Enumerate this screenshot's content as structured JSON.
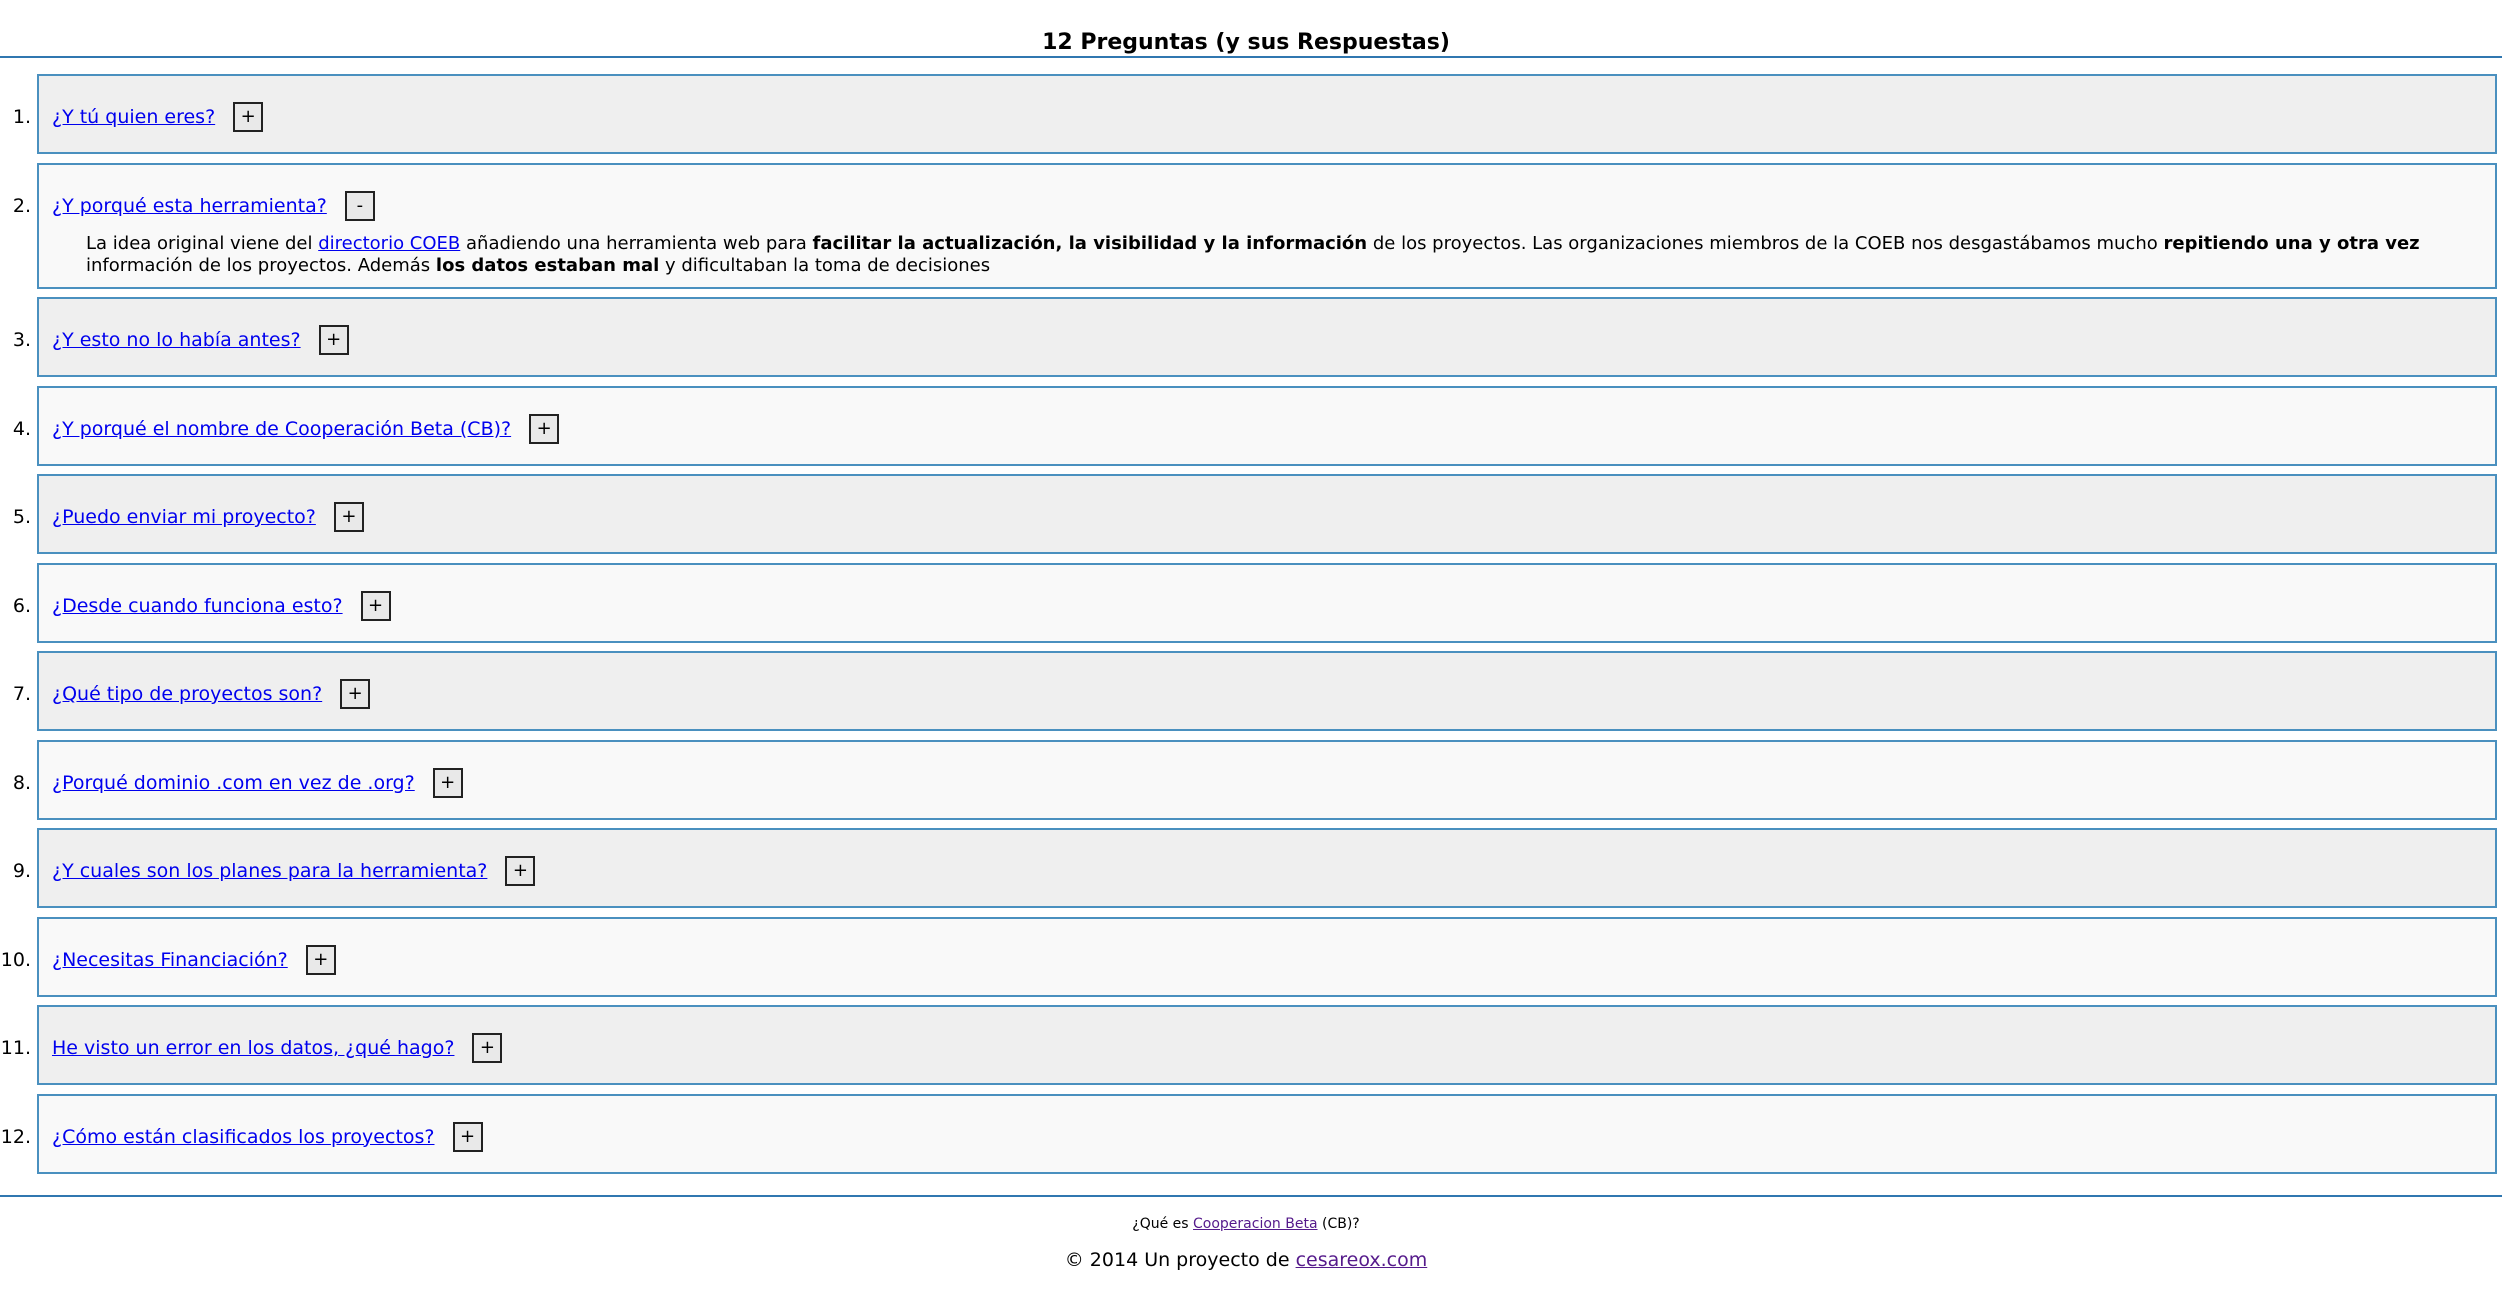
{
  "page": {
    "title": "12 Preguntas (y sus Respuestas)"
  },
  "faq": [
    {
      "number": "1.",
      "question": "¿Y tú quien eres?",
      "toggle": "+"
    },
    {
      "number": "2.",
      "question": "¿Y porqué esta herramienta?",
      "toggle": "-"
    },
    {
      "number": "3.",
      "question": "¿Y esto no lo había antes?",
      "toggle": "+"
    },
    {
      "number": "4.",
      "question": "¿Y porqué el nombre de Cooperación Beta (CB)?",
      "toggle": "+"
    },
    {
      "number": "5.",
      "question": "¿Puedo enviar mi proyecto?",
      "toggle": "+"
    },
    {
      "number": "6.",
      "question": "¿Desde cuando funciona esto?",
      "toggle": "+"
    },
    {
      "number": "7.",
      "question": "¿Qué tipo de proyectos son?",
      "toggle": "+"
    },
    {
      "number": "8.",
      "question": "¿Porqué dominio .com en vez de .org?",
      "toggle": "+"
    },
    {
      "number": "9.",
      "question": "¿Y cuales son los planes para la herramienta?",
      "toggle": "+"
    },
    {
      "number": "10.",
      "question": "¿Necesitas Financiación?",
      "toggle": "+"
    },
    {
      "number": "11.",
      "question": "He visto un error en los datos, ¿qué hago?",
      "toggle": "+"
    },
    {
      "number": "12.",
      "question": "¿Cómo están clasificados los proyectos?",
      "toggle": "+"
    }
  ],
  "answer_2": {
    "part1": "La idea original viene del ",
    "link": "directorio COEB",
    "part2": " añadiendo una herramienta web para ",
    "bold1": "facilitar la actualización, la visibilidad y la información",
    "part3": " de los proyectos. Las organizaciones miembros de la COEB nos desgastábamos mucho ",
    "bold2": "repitiendo una y otra vez",
    "part4": " información de los proyectos. Además ",
    "bold3": "los datos estaban mal",
    "part5": " y dificultaban la toma de decisiones"
  },
  "footer": {
    "q_before": "¿Qué es ",
    "q_link": "Cooperacion Beta",
    "q_after": " (CB)?",
    "credit_before": "© 2014 Un proyecto de ",
    "credit_link": "cesareox.com"
  }
}
